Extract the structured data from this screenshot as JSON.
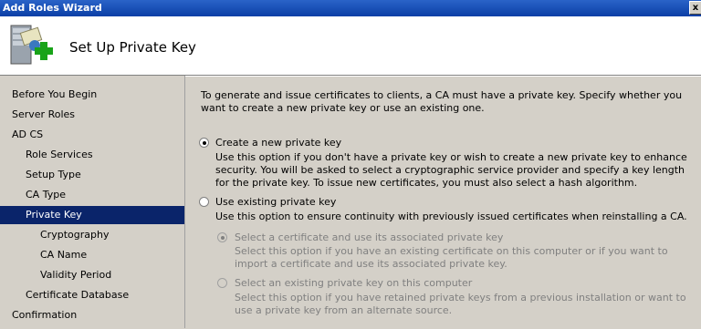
{
  "window": {
    "title": "Add Roles Wizard",
    "close_glyph": "x"
  },
  "header": {
    "title": "Set Up Private Key",
    "icon": "server-add-icon"
  },
  "nav": {
    "items": [
      {
        "label": "Before You Begin"
      },
      {
        "label": "Server Roles"
      },
      {
        "label": "AD CS"
      },
      {
        "label": "Role Services"
      },
      {
        "label": "Setup Type"
      },
      {
        "label": "CA Type"
      },
      {
        "label": "Private Key"
      },
      {
        "label": "Cryptography"
      },
      {
        "label": "CA Name"
      },
      {
        "label": "Validity Period"
      },
      {
        "label": "Certificate Database"
      },
      {
        "label": "Confirmation"
      }
    ],
    "selected": "Private Key"
  },
  "main": {
    "intro": "To generate and issue certificates to clients, a CA must have a private key. Specify whether you want to create a new private key or use an existing one.",
    "options": {
      "create_new": {
        "label": "Create a new private key",
        "description": "Use this option if you don't have a private key or wish to create a new private key to enhance security. You will be asked to select a cryptographic service provider and specify a key length for the private key. To issue new certificates, you must also select a hash algorithm.",
        "selected": true
      },
      "use_existing": {
        "label": "Use existing private key",
        "description": "Use this option to ensure continuity with previously issued certificates when reinstalling a CA.",
        "selected": false
      },
      "select_certificate": {
        "label": "Select a certificate and use its associated private key",
        "description": "Select this option if you have an existing certificate on this computer or if you want to import a certificate and use its associated private key.",
        "selected": true,
        "enabled": false
      },
      "select_existing_key": {
        "label": "Select an existing private key on this computer",
        "description": "Select this option if you have retained private keys from a previous installation or want to use a private key from an alternate source.",
        "selected": false,
        "enabled": false
      }
    }
  }
}
